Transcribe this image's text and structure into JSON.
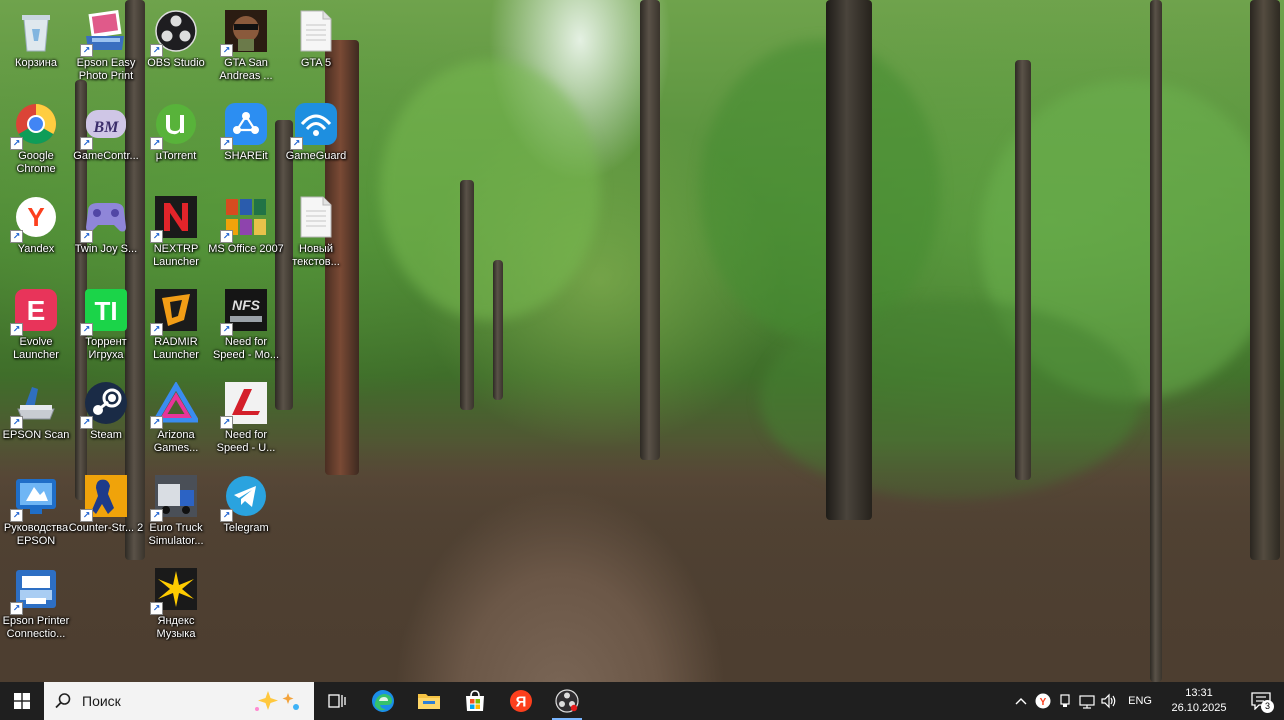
{
  "desktop": {
    "icons": [
      {
        "label": "Корзина",
        "icon": "recycle-bin-icon",
        "shortcut": false
      },
      {
        "label": "Google Chrome",
        "icon": "chrome-icon",
        "shortcut": true
      },
      {
        "label": "Yandex",
        "icon": "yandex-browser-icon",
        "shortcut": true
      },
      {
        "label": "Evolve Launcher",
        "icon": "evolve-launcher-icon",
        "shortcut": true
      },
      {
        "label": "EPSON Scan",
        "icon": "epson-scan-icon",
        "shortcut": true
      },
      {
        "label": "Руководства EPSON",
        "icon": "epson-manuals-icon",
        "shortcut": true
      },
      {
        "label": "Epson Printer Connectio...",
        "icon": "epson-printer-connection-icon",
        "shortcut": true
      },
      {
        "label": "Epson Easy Photo Print",
        "icon": "epson-easy-photo-print-icon",
        "shortcut": true
      },
      {
        "label": "GameContr...",
        "icon": "gamecontroller-icon",
        "shortcut": true
      },
      {
        "label": "Twin Joy S...",
        "icon": "twinjoy-icon",
        "shortcut": true
      },
      {
        "label": "Торрент Игруха",
        "icon": "torrent-igruha-icon",
        "shortcut": true
      },
      {
        "label": "Steam",
        "icon": "steam-icon",
        "shortcut": true
      },
      {
        "label": "Counter-Str... 2",
        "icon": "counter-strike-icon",
        "shortcut": true
      },
      {
        "label": "OBS Studio",
        "icon": "obs-studio-icon",
        "shortcut": true
      },
      {
        "label": "µTorrent",
        "icon": "utorrent-icon",
        "shortcut": true
      },
      {
        "label": "NEXTRP Launcher",
        "icon": "nextrp-launcher-icon",
        "shortcut": true
      },
      {
        "label": "RADMIR Launcher",
        "icon": "radmir-launcher-icon",
        "shortcut": true
      },
      {
        "label": "Arizona Games...",
        "icon": "arizona-games-icon",
        "shortcut": true
      },
      {
        "label": "Euro Truck Simulator...",
        "icon": "euro-truck-simulator-icon",
        "shortcut": true
      },
      {
        "label": "Яндекс Музыка",
        "icon": "yandex-music-icon",
        "shortcut": true
      },
      {
        "label": "GTA San Andreas ...",
        "icon": "gta-san-andreas-icon",
        "shortcut": true
      },
      {
        "label": "SHAREit",
        "icon": "shareit-icon",
        "shortcut": true
      },
      {
        "label": "MS Office 2007",
        "icon": "ms-office-icon",
        "shortcut": true
      },
      {
        "label": "Need for Speed - Mo...",
        "icon": "need-for-speed-mw-icon",
        "shortcut": true
      },
      {
        "label": "Need for Speed - U...",
        "icon": "need-for-speed-u-icon",
        "shortcut": true
      },
      {
        "label": "Telegram",
        "icon": "telegram-icon",
        "shortcut": true
      },
      {
        "label": "GTA 5",
        "icon": "text-file-icon",
        "shortcut": false
      },
      {
        "label": "GameGuard",
        "icon": "gameguard-icon",
        "shortcut": true
      },
      {
        "label": "Новый текстов...",
        "icon": "text-file-icon",
        "shortcut": false
      }
    ]
  },
  "taskbar": {
    "search_placeholder": "Поиск",
    "apps": [
      "task-view-icon",
      "edge-icon",
      "file-explorer-icon",
      "microsoft-store-icon",
      "yandex-browser-icon",
      "obs-studio-icon"
    ],
    "tray": {
      "language": "ENG",
      "time": "13:31",
      "date": "26.10.2025",
      "notification_count": "3"
    }
  }
}
